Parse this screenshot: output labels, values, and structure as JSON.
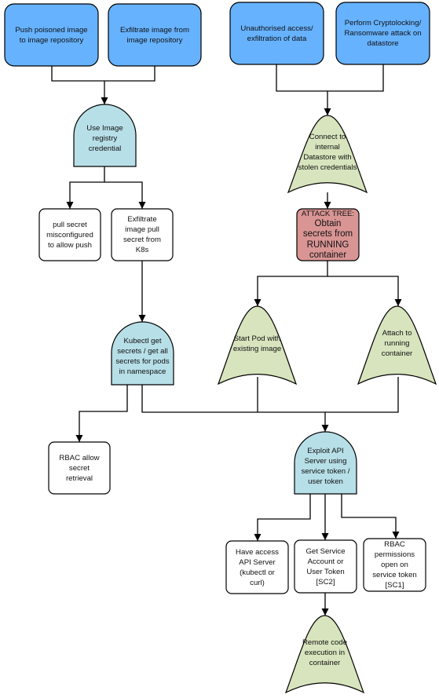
{
  "colors": {
    "goal_box": "#66b2ff",
    "and_gate": "#b7dfe8",
    "or_gate": "#d7e4bd",
    "attack_tree_box": "#d99594",
    "leaf_box": "#ffffff",
    "line": "#000000"
  },
  "nodes": {
    "push_poisoned": {
      "shape": "goal",
      "lines": [
        "Push poisoned image",
        "to image repository"
      ]
    },
    "exfiltrate_image": {
      "shape": "goal",
      "lines": [
        "Exfiltrate image from",
        "image repository"
      ]
    },
    "unauthorised_access": {
      "shape": "goal",
      "lines": [
        "Unauthorised access/",
        "exfiltration of data"
      ]
    },
    "cryptolocking": {
      "shape": "goal",
      "lines": [
        "Perform Cryptolocking/",
        "Ransomware attack on",
        "datastore"
      ]
    },
    "use_registry_credential": {
      "shape": "and-gate",
      "lines": [
        "Use Image",
        "registry",
        "credential"
      ]
    },
    "connect_datastore": {
      "shape": "or-gate",
      "lines": [
        "Connect to",
        "internal",
        "Datastore with",
        "stolen credentials"
      ]
    },
    "pull_secret_misconfigured": {
      "shape": "leaf",
      "lines": [
        "pull secret",
        "misconfigured",
        "to allow push"
      ]
    },
    "exfiltrate_pull_secret": {
      "shape": "leaf",
      "lines": [
        "Exfiltrate",
        "image pull",
        "secret from",
        "K8s"
      ]
    },
    "attack_tree_obtain_secrets": {
      "shape": "attack-tree",
      "lines": [
        "ATTACK TREE:",
        "Obtain",
        "secrets from",
        "RUNNING",
        "container"
      ]
    },
    "kubectl_get_secrets": {
      "shape": "and-gate",
      "lines": [
        "Kubectl get",
        "secrets / get all",
        "secrets for pods",
        "in namespace"
      ]
    },
    "start_pod": {
      "shape": "or-gate",
      "lines": [
        "Start Pod with",
        "existing image"
      ]
    },
    "attach_container": {
      "shape": "or-gate",
      "lines": [
        "Attach to",
        "running",
        "container"
      ]
    },
    "rbac_allow_secret": {
      "shape": "leaf",
      "lines": [
        "RBAC allow",
        "secret",
        "retrieval"
      ]
    },
    "exploit_api_server": {
      "shape": "and-gate",
      "lines": [
        "Exploit API",
        "Server using",
        "service token /",
        "user token"
      ]
    },
    "have_access_api": {
      "shape": "leaf",
      "lines": [
        "Have access",
        "API Server",
        "(kubectl or",
        "curl)"
      ]
    },
    "get_service_account": {
      "shape": "leaf",
      "lines": [
        "Get Service",
        "Account or",
        "User Token",
        "[SC2]"
      ]
    },
    "rbac_permissions_open": {
      "shape": "leaf",
      "lines": [
        "RBAC",
        "permissions",
        "open on",
        "service token",
        "[SC1]"
      ]
    },
    "remote_code_execution": {
      "shape": "or-gate",
      "lines": [
        "Remote code",
        "execution in",
        "container"
      ]
    }
  }
}
